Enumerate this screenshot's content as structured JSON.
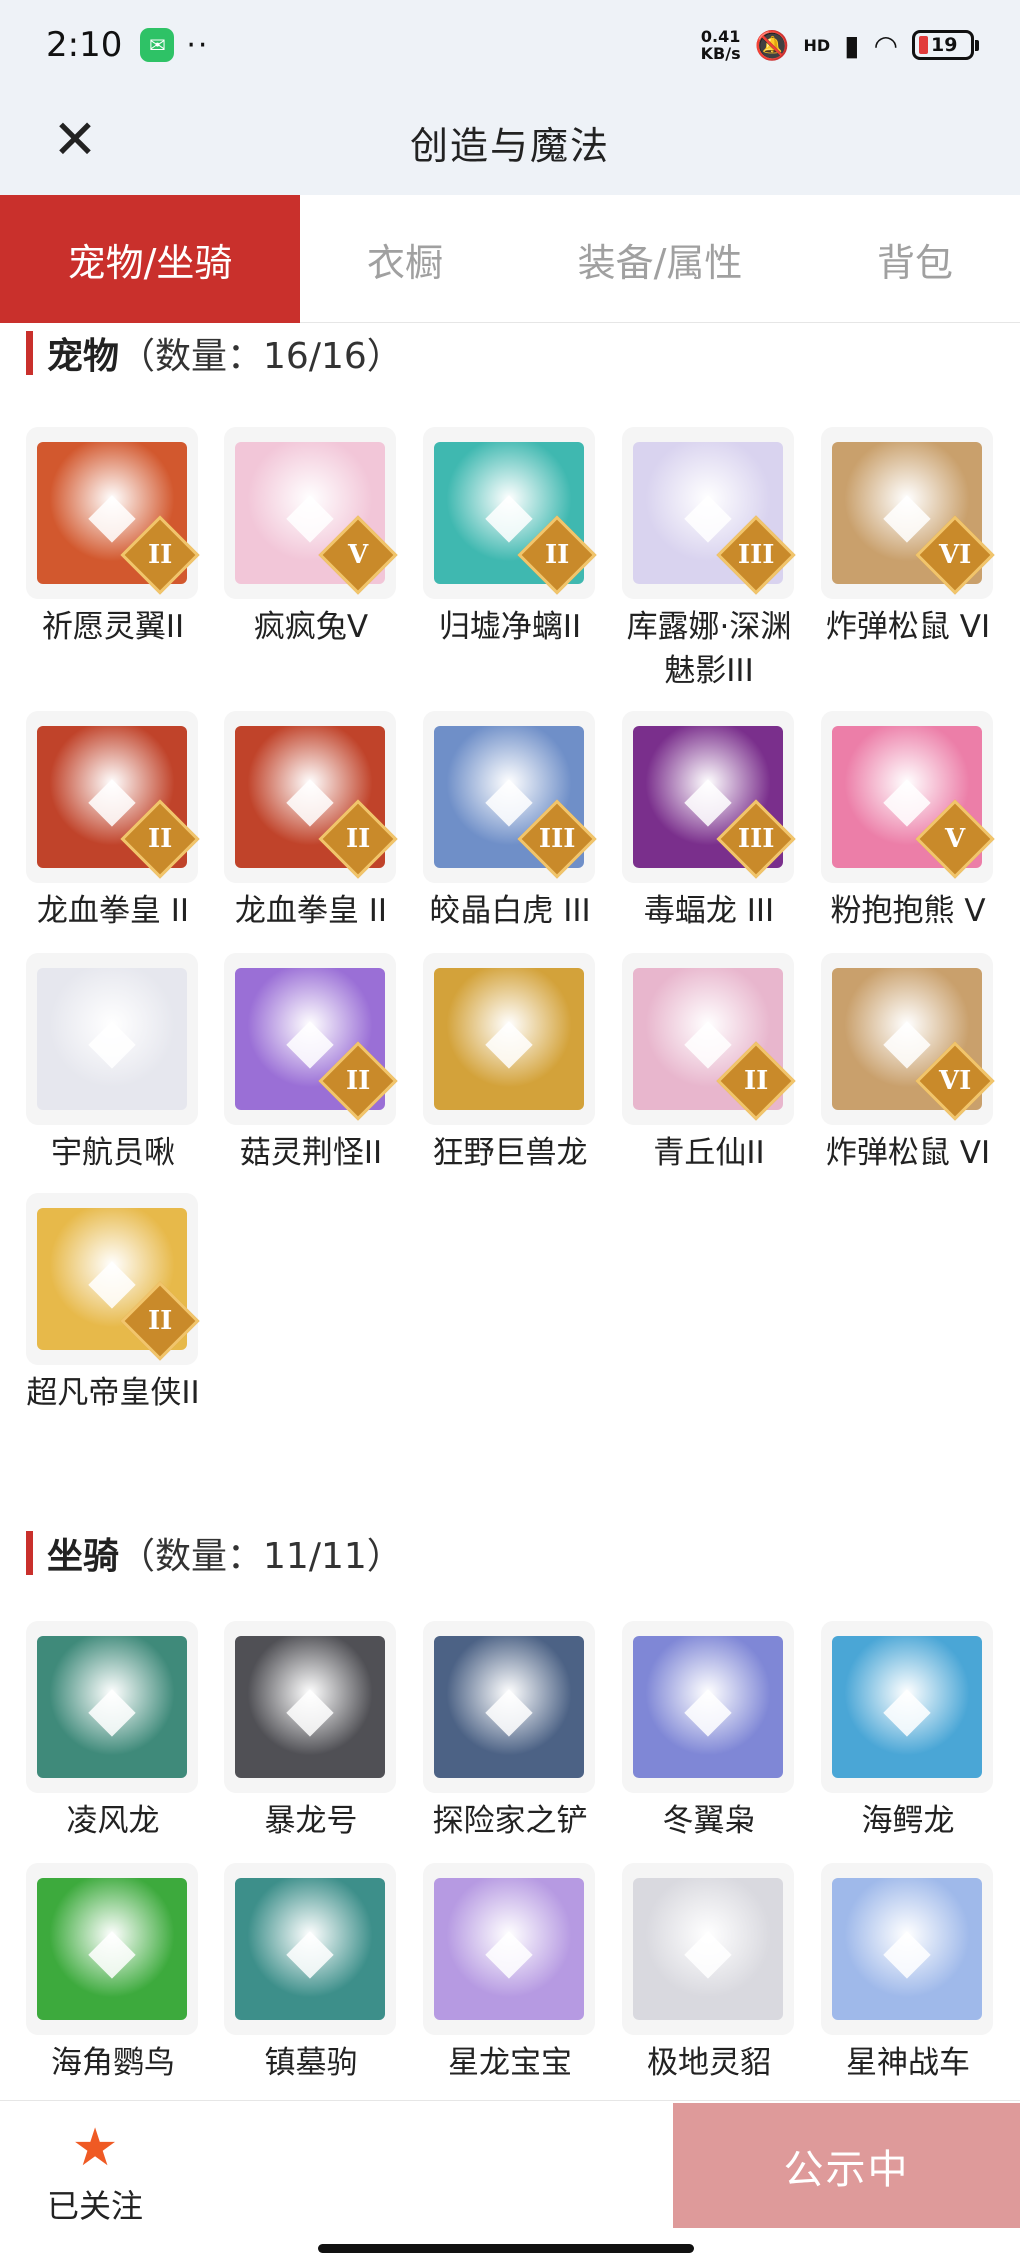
{
  "status_bar": {
    "time": "2:10",
    "speed_value": "0.41",
    "speed_unit": "KB/s",
    "network": "HD",
    "battery": "19"
  },
  "header": {
    "title": "创造与魔法"
  },
  "tabs": [
    {
      "label": "宠物/坐骑",
      "active": true
    },
    {
      "label": "衣橱",
      "active": false
    },
    {
      "label": "装备/属性",
      "active": false
    },
    {
      "label": "背包",
      "active": false
    }
  ],
  "pets": {
    "title": "宠物",
    "count_text": "（数量：16/16）",
    "items": [
      {
        "name": "祈愿灵翼II",
        "rank": "II",
        "color": "#d2582e"
      },
      {
        "name": "疯疯兔V",
        "rank": "V",
        "color": "#f2c6d8"
      },
      {
        "name": "归墟净螭II",
        "rank": "II",
        "color": "#3fb8b0"
      },
      {
        "name": "库露娜·深渊魅影III",
        "rank": "III",
        "color": "#d9d3ef"
      },
      {
        "name": "炸弹松鼠 VI",
        "rank": "VI",
        "color": "#c9a06c"
      },
      {
        "name": "龙血拳皇 II",
        "rank": "II",
        "color": "#c0432a"
      },
      {
        "name": "龙血拳皇 II",
        "rank": "II",
        "color": "#c0432a"
      },
      {
        "name": "皎晶白虎 III",
        "rank": "III",
        "color": "#6f8fc8"
      },
      {
        "name": "毒蝠龙 III",
        "rank": "III",
        "color": "#7a2f8c"
      },
      {
        "name": "粉抱抱熊 V",
        "rank": "V",
        "color": "#ec7ea8"
      },
      {
        "name": "宇航员啾",
        "rank": "",
        "color": "#e6e7ee"
      },
      {
        "name": "菇灵荆怪II",
        "rank": "II",
        "color": "#9a6fd6"
      },
      {
        "name": "狂野巨兽龙",
        "rank": "",
        "color": "#d3a23a"
      },
      {
        "name": "青丘仙II",
        "rank": "II",
        "color": "#e8b6cd"
      },
      {
        "name": "炸弹松鼠 VI",
        "rank": "VI",
        "color": "#c9a06c"
      },
      {
        "name": "超凡帝皇侠II",
        "rank": "II",
        "color": "#e7b94a"
      }
    ]
  },
  "mounts": {
    "title": "坐骑",
    "count_text": "（数量：11/11）",
    "items": [
      {
        "name": "凌风龙",
        "color": "#3f8a7a"
      },
      {
        "name": "暴龙号",
        "color": "#505055"
      },
      {
        "name": "探险家之铲",
        "color": "#4c6285"
      },
      {
        "name": "冬翼枭",
        "color": "#7f87d6"
      },
      {
        "name": "海鳄龙",
        "color": "#4aa6d6"
      },
      {
        "name": "海角鹦鸟",
        "color": "#3daa3d"
      },
      {
        "name": "镇墓驹",
        "color": "#3d8f8a"
      },
      {
        "name": "星龙宝宝",
        "color": "#b69ae2"
      },
      {
        "name": "极地灵貂",
        "color": "#d9d9df"
      },
      {
        "name": "星神战车",
        "color": "#9fb9ea"
      }
    ]
  },
  "bottom": {
    "follow_label": "已关注",
    "publish_label": "公示中"
  }
}
